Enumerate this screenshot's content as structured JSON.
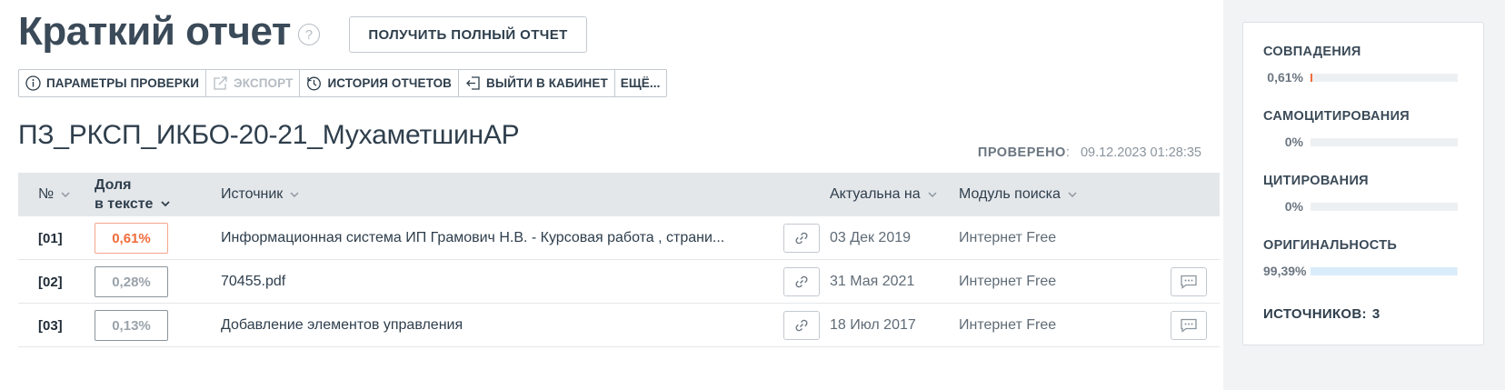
{
  "header": {
    "title": "Краткий отчет",
    "help_icon": "?",
    "full_report_button": "ПОЛУЧИТЬ ПОЛНЫЙ ОТЧЕТ"
  },
  "toolbar": {
    "items": [
      {
        "label": "ПАРАМЕТРЫ ПРОВЕРКИ",
        "icon": "info-icon",
        "enabled": true
      },
      {
        "label": "ЭКСПОРТ",
        "icon": "export-icon",
        "enabled": false
      },
      {
        "label": "ИСТОРИЯ ОТЧЕТОВ",
        "icon": "history-icon",
        "enabled": true
      },
      {
        "label": "ВЫЙТИ В КАБИНЕТ",
        "icon": "logout-icon",
        "enabled": true
      },
      {
        "label": "ЕЩЁ...",
        "icon": "",
        "enabled": true
      }
    ]
  },
  "document": {
    "name": "ПЗ_РКСП_ИКБО-20-21_МухаметшинАР",
    "checked_label": "ПРОВЕРЕНО",
    "checked_value": "09.12.2023 01:28:35"
  },
  "table": {
    "columns": {
      "num": "№",
      "share_line1": "Доля",
      "share_line2": "в тексте",
      "source": "Источник",
      "actual": "Актуальна на",
      "module": "Модуль поиска"
    },
    "rows": [
      {
        "num": "[01]",
        "share": "0,61%",
        "highlight": true,
        "source": "Информационная система ИП Грамович Н.В. - Курсовая работа , страни...",
        "date": "03 Дек 2019",
        "module": "Интернет Free",
        "has_comment": false
      },
      {
        "num": "[02]",
        "share": "0,28%",
        "highlight": false,
        "source": "70455.pdf",
        "date": "31 Мая 2021",
        "module": "Интернет Free",
        "has_comment": true
      },
      {
        "num": "[03]",
        "share": "0,13%",
        "highlight": false,
        "source": "Добавление элементов управления",
        "date": "18 Июл 2017",
        "module": "Интернет Free",
        "has_comment": true
      }
    ]
  },
  "summary": {
    "matches": {
      "label": "СОВПАДЕНИЯ",
      "value": "0,61%",
      "fraction": 0.0061,
      "color": "#f06b3b"
    },
    "self_citations": {
      "label": "САМОЦИТИРОВАНИЯ",
      "value": "0%",
      "fraction": 0,
      "color": "#3db8e8"
    },
    "citations": {
      "label": "ЦИТИРОВАНИЯ",
      "value": "0%",
      "fraction": 0,
      "color": "#3db8e8"
    },
    "originality": {
      "label": "ОРИГИНАЛЬНОСТЬ",
      "value": "99,39%",
      "fraction": 0.9939,
      "color": "#d9ecfa"
    },
    "sources_label": "ИСТОЧНИКОВ:",
    "sources_count": "3"
  }
}
